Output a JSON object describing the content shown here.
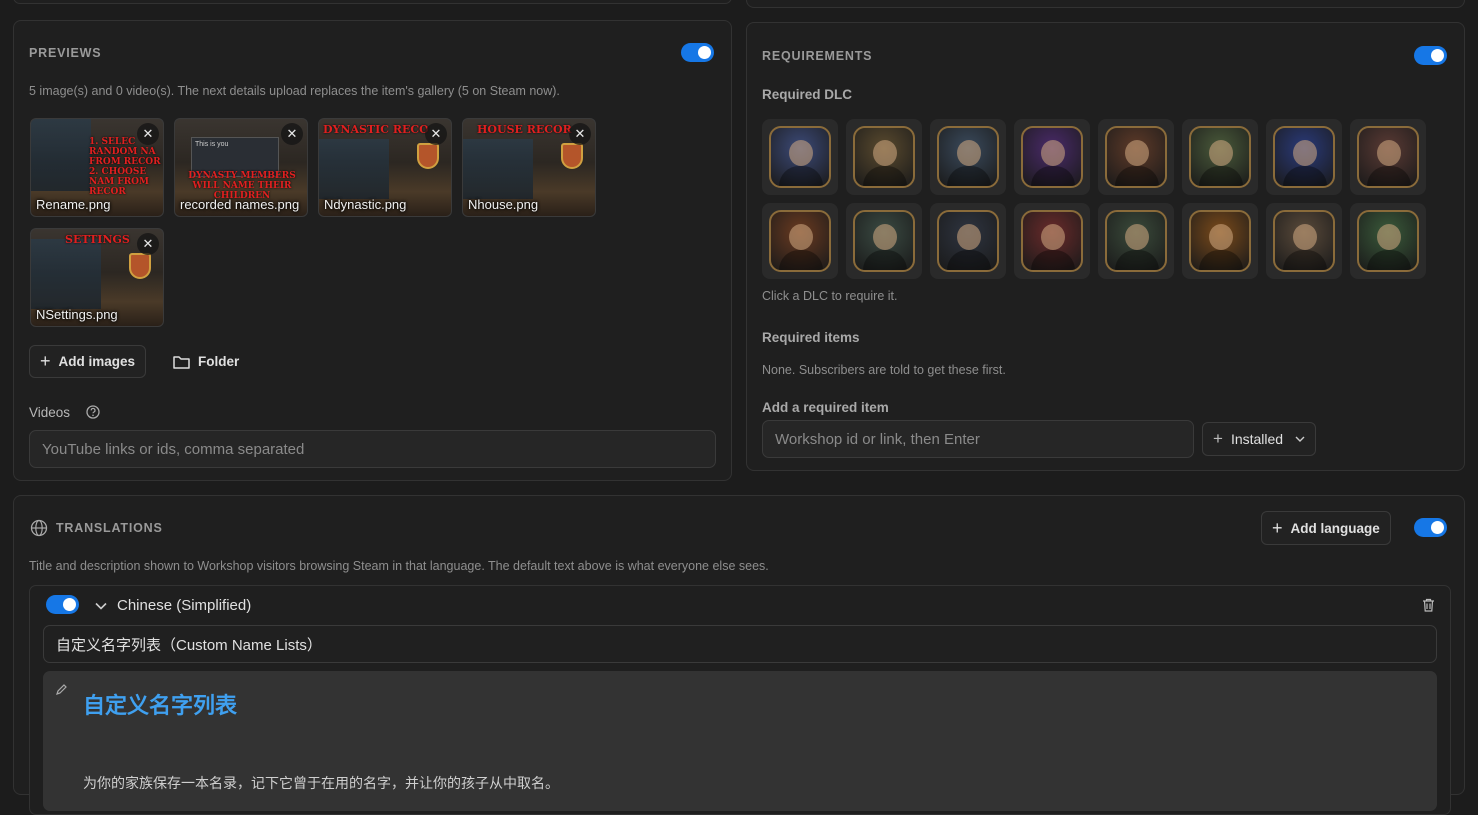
{
  "previews": {
    "title": "PREVIEWS",
    "info": "5 image(s) and 0 video(s). The next details upload replaces the item's gallery (5 on Steam now).",
    "images": [
      {
        "name": "Rename.png",
        "overlay": "1. SELEC RANDOM NA FROM RECOR 2. CHOOSE NAM FROM RECOR"
      },
      {
        "name": "recorded names.png",
        "overlay": "DYNASTY MEMBERS WILL NAME THEIR CHILDREN",
        "popup": "This is you"
      },
      {
        "name": "Ndynastic.png",
        "overlay": "DYNASTIC RECO"
      },
      {
        "name": "Nhouse.png",
        "overlay": "HOUSE RECOR"
      },
      {
        "name": "NSettings.png",
        "overlay": "SETTINGS"
      }
    ],
    "remove_glyph": "✕",
    "add_images": "Add images",
    "folder": "Folder",
    "videos_label": "Videos",
    "videos_placeholder": "YouTube links or ids, comma separated"
  },
  "requirements": {
    "title": "REQUIREMENTS",
    "required_dlc": "Required DLC",
    "dlc_hint": "Click a DLC to require it.",
    "dlc_colors": [
      "#3c4a78",
      "#5a4a2e",
      "#3a4a5c",
      "#4a2a6a",
      "#5e3a28",
      "#4a5a3a",
      "#2a3a7a",
      "#5a3a34",
      "#6a3a20",
      "#3a4a42",
      "#2e3440",
      "#6a2a2a",
      "#3a4a3a",
      "#7a4a1a",
      "#5a4a3a",
      "#3a5a3a"
    ],
    "required_items": "Required items",
    "items_hint": "None. Subscribers are told to get these first.",
    "add_item_label": "Add a required item",
    "add_item_placeholder": "Workshop id or link, then Enter",
    "installed": "Installed"
  },
  "translations": {
    "title": "TRANSLATIONS",
    "add_language": "Add language",
    "info": "Title and description shown to Workshop visitors browsing Steam in that language. The default text above is what everyone else sees.",
    "language": "Chinese (Simplified)",
    "title_value": "自定义名字列表（Custom Name Lists）",
    "desc_heading": "自定义名字列表",
    "desc_line": "为你的家族保存一本名录，记下它曾于在用的名字，并让你的孩子从中取名。"
  }
}
